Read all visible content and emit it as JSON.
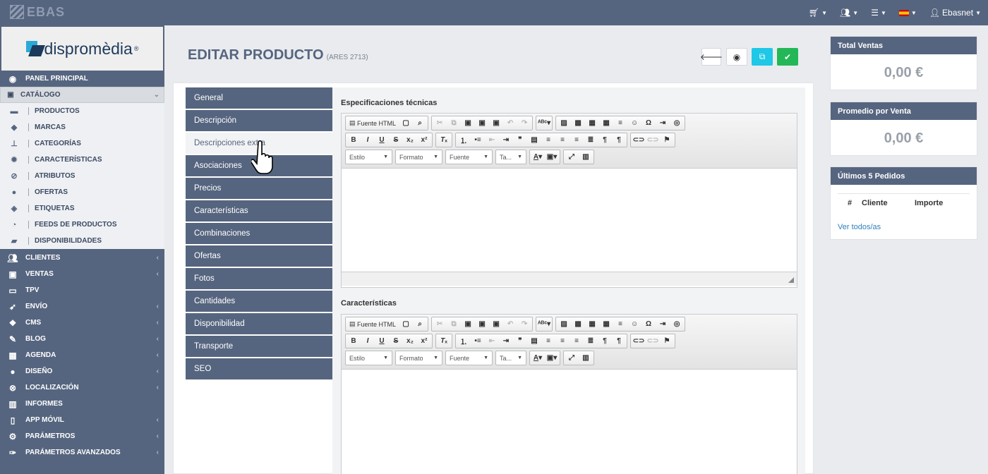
{
  "topbar": {
    "logo_text": "EBAS",
    "user_name": "Ebasnet"
  },
  "brand": {
    "text": "dispromèdia",
    "registered": "®"
  },
  "sidebar": {
    "main_top": {
      "label": "PANEL PRINCIPAL",
      "icon": "dashboard-icon"
    },
    "catalog": {
      "label": "CATÁLOGO",
      "icon": "catalog-icon"
    },
    "catalog_items": [
      {
        "label": "PRODUCTOS",
        "icon": "briefcase-icon"
      },
      {
        "label": "MARCAS",
        "icon": "tag-icon"
      },
      {
        "label": "CATEGORÍAS",
        "icon": "sitemap-icon"
      },
      {
        "label": "CARACTERÍSTICAS",
        "icon": "gear-icon"
      },
      {
        "label": "ATRIBUTOS",
        "icon": "check-circle-icon"
      },
      {
        "label": "OFERTAS",
        "icon": "exclamation-icon"
      },
      {
        "label": "ETIQUETAS",
        "icon": "tags-icon"
      },
      {
        "label": "FEEDS DE PRODUCTOS",
        "icon": "rss-icon"
      },
      {
        "label": "DISPONIBILIDADES",
        "icon": "truck-icon"
      }
    ],
    "main_items": [
      {
        "label": "CLIENTES",
        "icon": "users-icon",
        "chevron": true
      },
      {
        "label": "VENTAS",
        "icon": "money-icon",
        "chevron": true
      },
      {
        "label": "TPV",
        "icon": "credit-card-icon",
        "chevron": false
      },
      {
        "label": "ENVÍO",
        "icon": "paper-plane-icon",
        "chevron": true
      },
      {
        "label": "CMS",
        "icon": "cubes-icon",
        "chevron": true
      },
      {
        "label": "BLOG",
        "icon": "blog-icon",
        "chevron": true
      },
      {
        "label": "AGENDA",
        "icon": "calendar-icon",
        "chevron": true
      },
      {
        "label": "DISEÑO",
        "icon": "tint-icon",
        "chevron": true
      },
      {
        "label": "LOCALIZACIÓN",
        "icon": "compass-icon",
        "chevron": true
      },
      {
        "label": "INFORMES",
        "icon": "bar-chart-icon",
        "chevron": false
      },
      {
        "label": "APP MÓVIL",
        "icon": "mobile-icon",
        "chevron": true
      },
      {
        "label": "PARÁMETROS",
        "icon": "cogs-icon",
        "chevron": true
      },
      {
        "label": "PARÁMETROS AVANZADOS",
        "icon": "wrench-icon",
        "chevron": true
      }
    ]
  },
  "page": {
    "title": "EDITAR PRODUCTO",
    "subtitle": "(ARES 2713)"
  },
  "tabs": [
    "General",
    "Descripción",
    "Descripciones extra",
    "Asociaciones",
    "Precios",
    "Características",
    "Combinaciones",
    "Ofertas",
    "Fotos",
    "Cantidades",
    "Disponibilidad",
    "Transporte",
    "SEO"
  ],
  "active_tab": "Descripciones extra",
  "editors": [
    {
      "label": "Especificaciones técnicas"
    },
    {
      "label": "Características"
    }
  ],
  "toolbar": {
    "source_label": "Fuente HTML",
    "combo_estilo": "Estilo",
    "combo_formato": "Formato",
    "combo_fuente": "Fuente",
    "combo_tamano": "Ta..."
  },
  "widgets": {
    "total_ventas": {
      "title": "Total Ventas",
      "value": "0,00 €"
    },
    "promedio": {
      "title": "Promedio por Venta",
      "value": "0,00 €"
    },
    "pedidos": {
      "title": "Últimos 5 Pedidos",
      "col_num": "#",
      "col_cliente": "Cliente",
      "col_importe": "Importe",
      "link": "Ver todos/as"
    }
  },
  "colors": {
    "sidebar": "#56657f",
    "accent_cyan": "#1ec8e6",
    "accent_green": "#23b758"
  }
}
